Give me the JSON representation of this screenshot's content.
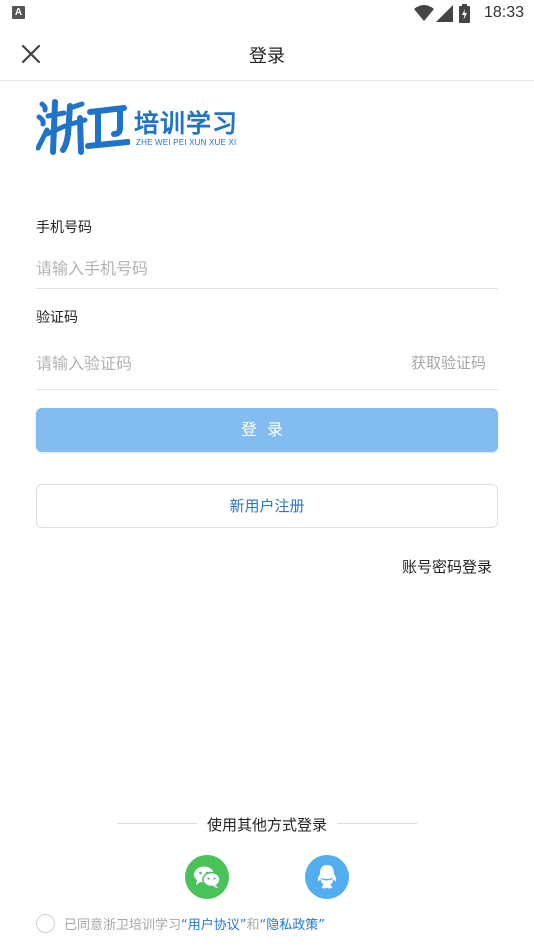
{
  "status_bar": {
    "notification_badge": "A",
    "time": "18:33"
  },
  "header": {
    "title": "登录"
  },
  "logo": {
    "cn": "培训学习",
    "en": "ZHE WEI PEI XUN XUE XI"
  },
  "form": {
    "phone_label": "手机号码",
    "phone_placeholder": "请输入手机号码",
    "code_label": "验证码",
    "code_placeholder": "请输入验证码",
    "get_code": "获取验证码"
  },
  "buttons": {
    "login": "登录",
    "register": "新用户注册",
    "password_login": "账号密码登录"
  },
  "other_login": {
    "title": "使用其他方式登录"
  },
  "agreement": {
    "prefix": "已同意浙卫培训学习",
    "user_agreement": "“用户协议”",
    "and": "和",
    "privacy_policy": "“隐私政策”"
  },
  "colors": {
    "primary_button": "#83bcf0",
    "brand_blue": "#1f74c7",
    "link": "#2a78c5",
    "wechat": "#49c25a",
    "qq": "#53aef0"
  }
}
